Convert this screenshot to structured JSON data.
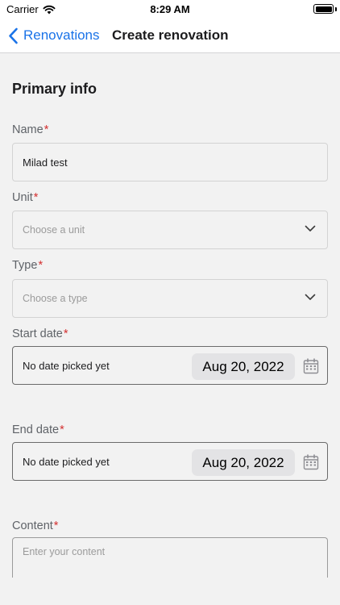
{
  "status_bar": {
    "carrier": "Carrier",
    "time": "8:29 AM"
  },
  "nav": {
    "back_label": "Renovations",
    "title": "Create renovation"
  },
  "form": {
    "section_title": "Primary info",
    "required_mark": "*",
    "name": {
      "label": "Name",
      "value": "Milad test"
    },
    "unit": {
      "label": "Unit",
      "placeholder": "Choose a unit"
    },
    "type": {
      "label": "Type",
      "placeholder": "Choose a type"
    },
    "start_date": {
      "label": "Start date",
      "hint": "No date picked yet",
      "value": "Aug 20, 2022"
    },
    "end_date": {
      "label": "End date",
      "hint": "No date picked yet",
      "value": "Aug 20, 2022"
    },
    "content": {
      "label": "Content",
      "placeholder": "Enter your content"
    }
  },
  "colors": {
    "accent": "#1a73e8",
    "required": "#d32f2f",
    "background": "#f2f2f2"
  }
}
